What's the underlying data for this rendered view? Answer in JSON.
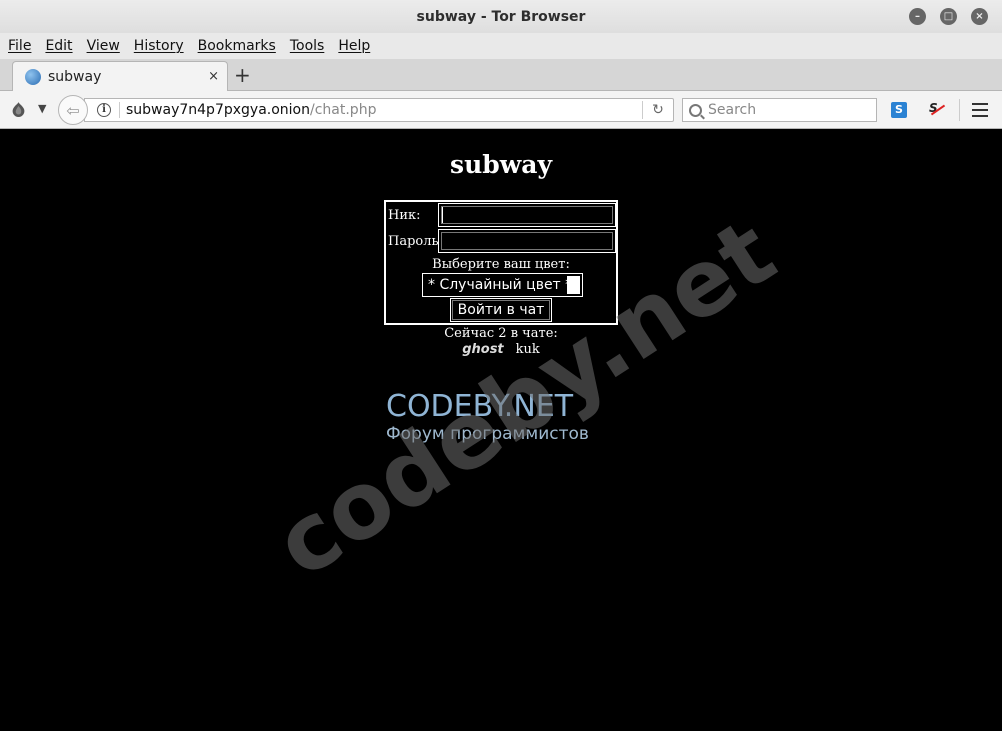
{
  "window": {
    "title": "subway - Tor Browser"
  },
  "menu": [
    "File",
    "Edit",
    "View",
    "History",
    "Bookmarks",
    "Tools",
    "Help"
  ],
  "tab": {
    "title": "subway",
    "close": "×"
  },
  "newtab": "+",
  "address": {
    "host": "subway7n4p7pxgya.onion",
    "path": "/chat.php"
  },
  "search": {
    "placeholder": "Search"
  },
  "page": {
    "title": "subway",
    "nick_label": "Ник:",
    "password_label": "Пароль:",
    "color_label": "Выберите ваш цвет:",
    "color_selected": "* Случайный цвет *",
    "enter_button": "Войти в чат",
    "online_text": "Сейчас 2 в чате:",
    "users": [
      "ghost",
      "kuk"
    ]
  },
  "logo": {
    "main": "CODEBY.NET",
    "sub": "Форум программистов"
  },
  "watermark": "codeby.net",
  "colors": {
    "background": "#000000",
    "text": "#ffffff",
    "logo": "#8fb4d4"
  }
}
